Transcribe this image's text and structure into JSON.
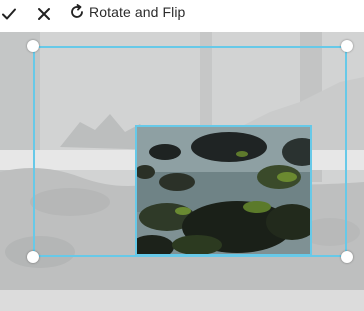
{
  "toolbar": {
    "confirm_icon": "checkmark-icon",
    "cancel_icon": "close-icon",
    "rotate_icon": "rotate-icon",
    "rotate_label": "Rotate and Flip"
  },
  "colors": {
    "crop_border": "#67c9e8",
    "handle": "#ffffff"
  }
}
